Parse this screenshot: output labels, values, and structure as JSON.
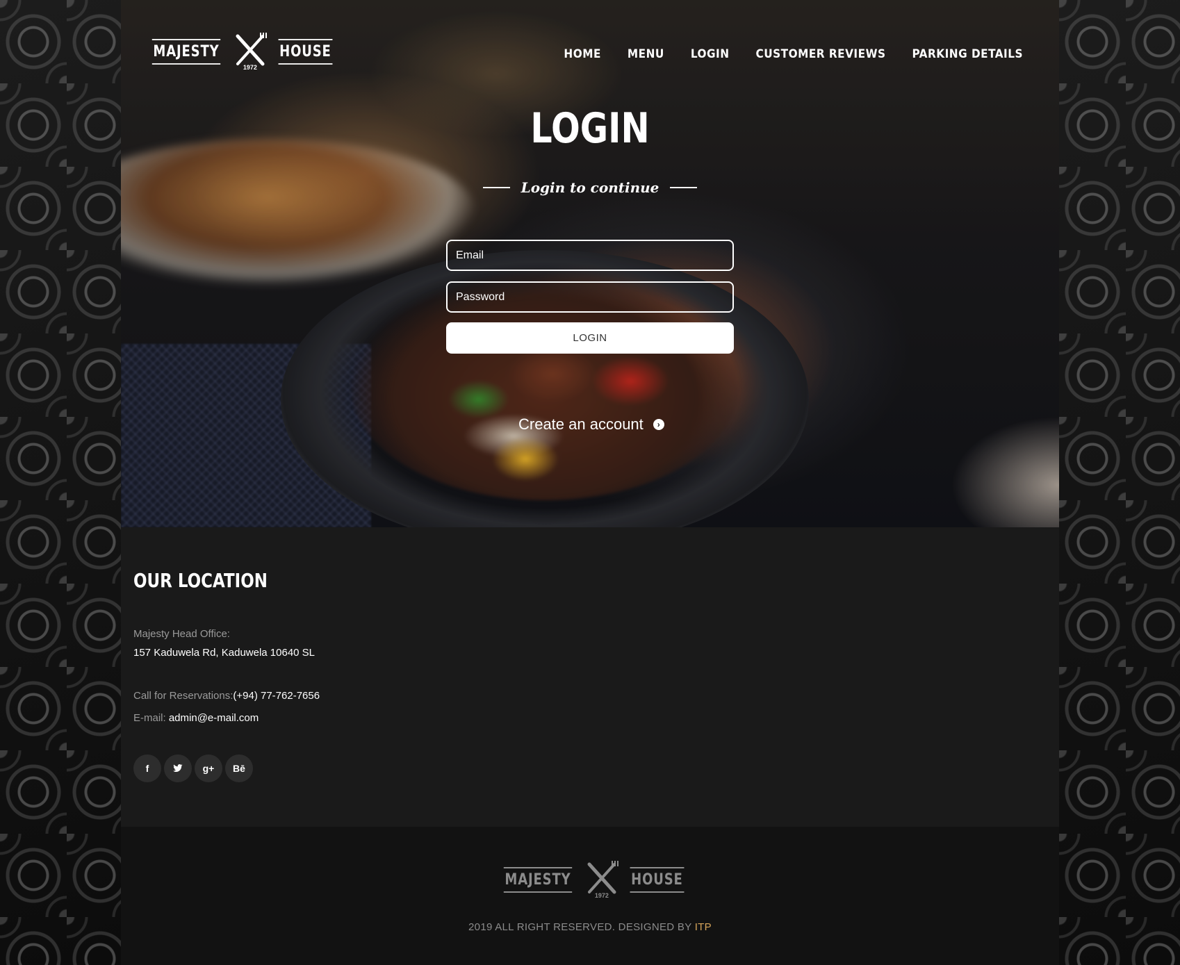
{
  "brand": {
    "left_word": "MAJESTY",
    "right_word": "HOUSE",
    "year": "1972"
  },
  "nav": {
    "items": [
      {
        "label": "HOME"
      },
      {
        "label": "MENU"
      },
      {
        "label": "LOGIN"
      },
      {
        "label": "CUSTOMER REVIEWS"
      },
      {
        "label": "PARKING DETAILS"
      }
    ]
  },
  "hero": {
    "title": "LOGIN",
    "subtitle": "Login to continue"
  },
  "form": {
    "email_placeholder": "Email",
    "password_placeholder": "Password",
    "login_button": "LOGIN",
    "create_account": "Create an account"
  },
  "location": {
    "heading": "OUR LOCATION",
    "office_label": "Majesty Head Office:",
    "address": "157 Kaduwela Rd, Kaduwela 10640 SL",
    "reservations_label": "Call for Reservations:",
    "reservations_phone": "(+94) 77-762-7656",
    "email_label": "E-mail:",
    "email_value": "admin@e-mail.com",
    "socials": [
      {
        "icon": "facebook-icon",
        "glyph": "f"
      },
      {
        "icon": "twitter-icon",
        "glyph": "t"
      },
      {
        "icon": "google-plus-icon",
        "glyph": "g+"
      },
      {
        "icon": "behance-icon",
        "glyph": "Bē"
      }
    ]
  },
  "footer": {
    "copyright_text": "2019 ALL RIGHT RESERVED. DESIGNED BY ",
    "designer": "ITP",
    "accent_color": "#d6a45a"
  }
}
